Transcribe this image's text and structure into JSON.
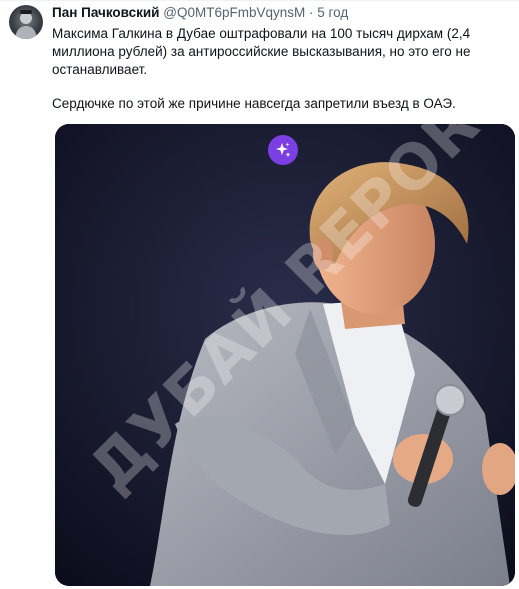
{
  "tweet": {
    "author_name": "Пан Пачковский",
    "author_handle": "@Q0MT6pFmbVqynsM",
    "separator": "·",
    "time": "5 год",
    "paragraphs": [
      "Максима Галкина в Дубае оштрафовали на 100 тысяч дирхам (2,4 миллиона рублей) за антироссийские высказывания, но это его не останавливает.",
      "Сердючке по этой же причине навсегда запретили въезд в ОАЭ."
    ]
  },
  "media": {
    "watermark": "ДУБАЙ REPORT",
    "badge_icon": "sparkle-icon",
    "badge_color": "#7b3fe4"
  }
}
